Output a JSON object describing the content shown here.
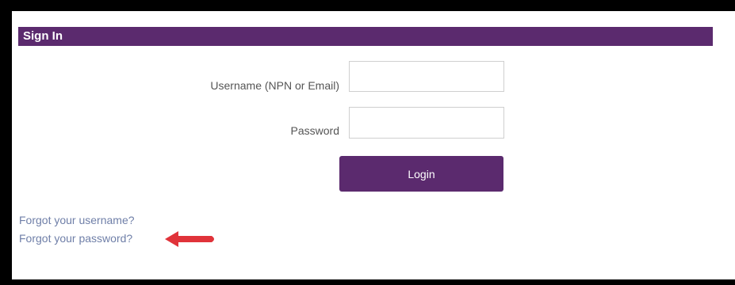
{
  "signin": {
    "title": "Sign In",
    "username_label": "Username (NPN or Email)",
    "username_value": "",
    "password_label": "Password",
    "password_value": "",
    "login_label": "Login"
  },
  "links": {
    "forgot_username": "Forgot your username?",
    "forgot_password": "Forgot your password?"
  },
  "annotation": {
    "icon": "arrow-left-icon",
    "color": "#e0333a"
  },
  "colors": {
    "brand": "#5b2a6e",
    "link": "#6f7fa8"
  }
}
